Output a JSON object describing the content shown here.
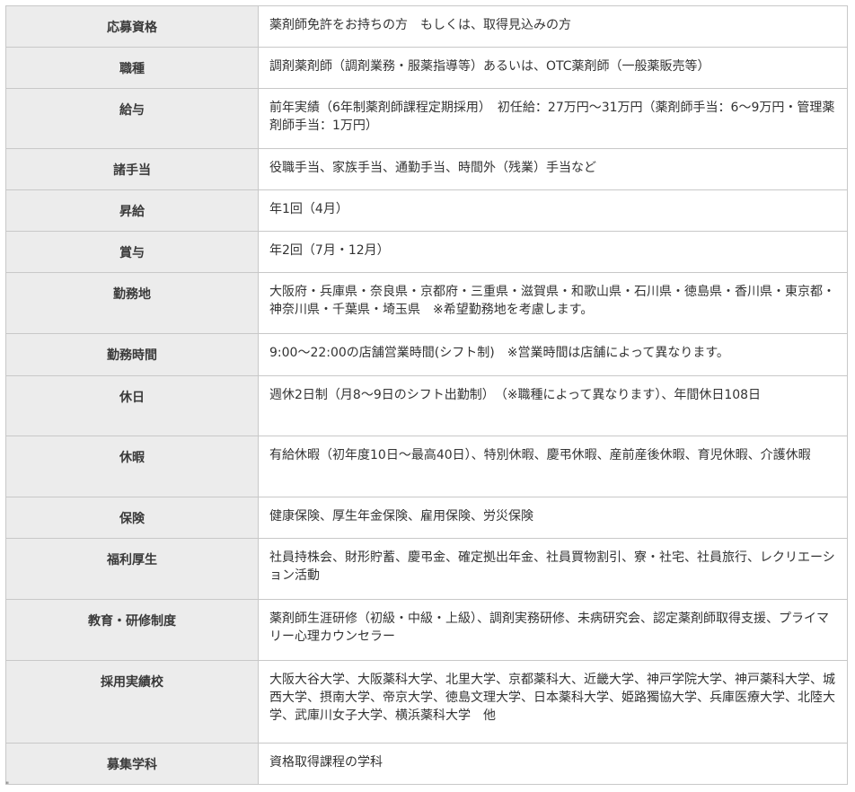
{
  "rows": [
    {
      "label": "応募資格",
      "value": "薬剤師免許をお持ちの方　もしくは、取得見込みの方"
    },
    {
      "label": "職種",
      "value": "調剤薬剤師（調剤業務・服薬指導等）あるいは、OTC薬剤師（一般薬販売等）"
    },
    {
      "label": "給与",
      "value": "前年実績（6年制薬剤師課程定期採用）　初任給：27万円〜31万円（薬剤師手当：6〜9万円・管理薬剤師手当：1万円）"
    },
    {
      "label": "諸手当",
      "value": "役職手当、家族手当、通勤手当、時間外（残業）手当など"
    },
    {
      "label": "昇給",
      "value": "年1回（4月）"
    },
    {
      "label": "賞与",
      "value": "年2回（7月・12月）"
    },
    {
      "label": "勤務地",
      "value": "大阪府・兵庫県・奈良県・京都府・三重県・滋賀県・和歌山県・石川県・徳島県・香川県・東京都・神奈川県・千葉県・埼玉県　※希望勤務地を考慮します。"
    },
    {
      "label": "勤務時間",
      "value": "9:00〜22:00の店舗営業時間(シフト制)　※営業時間は店舗によって異なります。"
    },
    {
      "label": "休日",
      "value": "週休2日制（月8〜9日のシフト出勤制）　（※職種によって異なります）、年間休日108日"
    },
    {
      "label": "休暇",
      "value": "有給休暇（初年度10日〜最高40日）、特別休暇、慶弔休暇、産前産後休暇、育児休暇、介護休暇"
    },
    {
      "label": "保険",
      "value": "健康保険、厚生年金保険、雇用保険、労災保険"
    },
    {
      "label": "福利厚生",
      "value": "社員持株会、財形貯蓄、慶弔金、確定拠出年金、社員買物割引、寮・社宅、社員旅行、レクリエーション活動"
    },
    {
      "label": "教育・研修制度",
      "value": "薬剤師生涯研修（初級・中級・上級）、調剤実務研修、未病研究会、認定薬剤師取得支援、プライマリー心理カウンセラー"
    },
    {
      "label": "採用実績校",
      "value": "大阪大谷大学、大阪薬科大学、北里大学、京都薬科大、近畿大学、神戸学院大学、神戸薬科大学、城西大学、摂南大学、帝京大学、徳島文理大学、日本薬科大学、姫路獨協大学、兵庫医療大学、北陸大学、武庫川女子大学、横浜薬科大学　他"
    },
    {
      "label": "募集学科",
      "value": "資格取得課程の学科"
    }
  ],
  "footer_mark": "\""
}
